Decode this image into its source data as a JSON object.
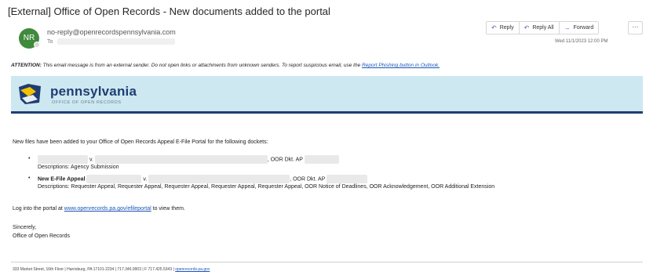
{
  "email": {
    "subject": "[External] Office of Open Records - New documents added to the portal",
    "avatar_initials": "NR",
    "sender": "no-reply@openrecordspennsylvania.com",
    "to_label": "To",
    "date": "Wed 11/1/2023 12:00 PM"
  },
  "actions": {
    "reply": "Reply",
    "reply_all": "Reply All",
    "forward": "Forward",
    "more": "···"
  },
  "attention": {
    "label": "ATTENTION:",
    "text": " This email message is from an external sender. Do not open links or attachments from unknown senders. To report suspicious email, use the ",
    "link": "Report Phishing button in Outlook."
  },
  "banner": {
    "name": "pennsylvania",
    "sub": "OFFICE OF OPEN RECORDS",
    "colors": {
      "background": "#cde8f0",
      "navy": "#1f3d73"
    }
  },
  "body": {
    "intro": "New files have been added to your Office of Open Records Appeal E-File Portal for the following dockets:",
    "item1_v": "v.",
    "item1_docket": ", OOR Dkt. AP",
    "item1_desc": "Descriptions: Agency Submission",
    "item2_title": "New E-File Appeal",
    "item2_v": "v.",
    "item2_docket": ", OOR Dkt. AP",
    "item2_desc": "Descriptions: Requester Appeal, Requester Appeal, Requester Appeal, Requester Appeal, Requester Appeal, OOR Notice of Deadlines, OOR Acknowledgement, OOR Additional Extension",
    "login_pre": "Log into the portal at ",
    "login_link": "www.openrecords.pa.gov/efileportal",
    "login_post": " to view them.",
    "closing": "Sincerely,",
    "signature": "Office of Open Records"
  },
  "footer": {
    "text": "333 Market Street, 16th Floor | Harrisburg, PA 17101-2234 | 717.346.9903 | F 717.425.5343 | ",
    "link": "openrecords.pa.gov"
  }
}
